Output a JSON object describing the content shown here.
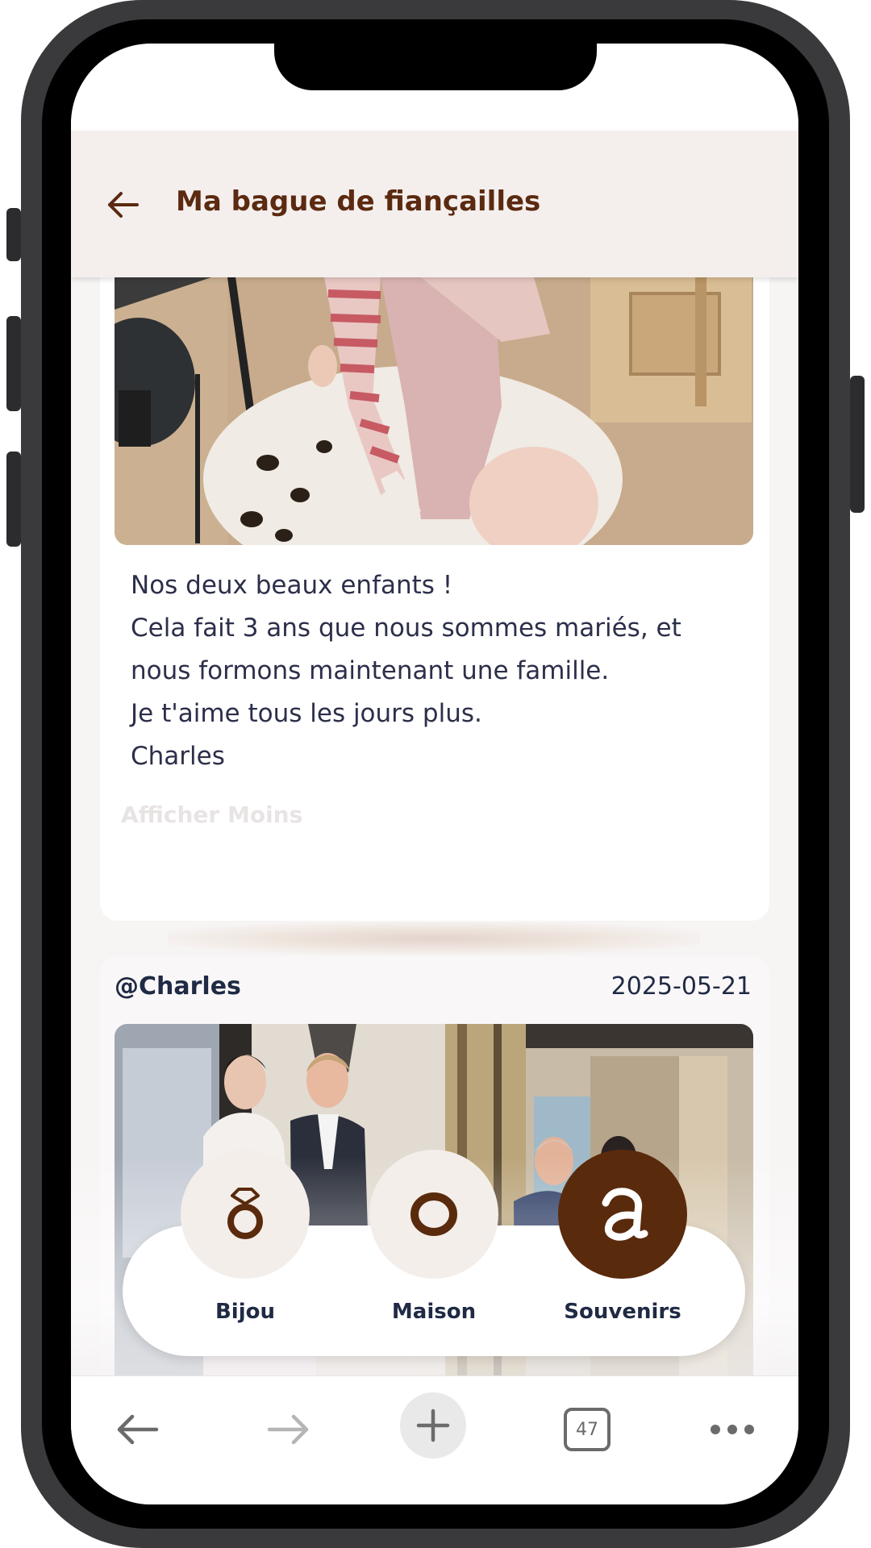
{
  "header": {
    "title": "Ma bague de fiançailles"
  },
  "post1": {
    "caption_lines": [
      "Nos deux beaux enfants !",
      "Cela fait 3 ans que nous sommes mariés, et",
      "nous formons maintenant une famille.",
      "Je t'aime tous les jours plus.",
      "Charles"
    ],
    "toggle_label": "Afficher Moins"
  },
  "post2": {
    "author": "@Charles",
    "date": "2025-05-21"
  },
  "tabs": [
    {
      "label": "Bijou",
      "icon": "ring-icon",
      "active": false
    },
    {
      "label": "Maison",
      "icon": "house-icon",
      "active": false
    },
    {
      "label": "Souvenirs",
      "icon": "souvenirs-icon",
      "active": true
    }
  ],
  "browser": {
    "tab_count": "47"
  },
  "colors": {
    "brand_brown": "#5a2a0c",
    "text_navy": "#1f2a44"
  }
}
